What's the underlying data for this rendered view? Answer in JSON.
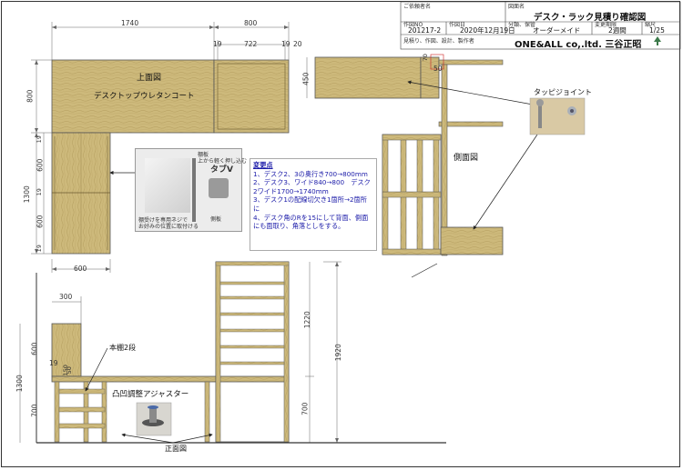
{
  "title_block": {
    "client_label": "ご依頼者名",
    "drawing_name_label": "図面名",
    "drawing_name": "デスク・ラック見積り確認図",
    "work_no_label": "作図NO",
    "work_no": "201217-2",
    "date_label": "作図日",
    "date": "2020年12月19日",
    "category_label": "分類、保管",
    "category": "オーダーメイド",
    "delivery_label": "変更期限",
    "delivery": "2週間",
    "scale_label": "縮尺",
    "scale": "1/25",
    "maker_label": "見積り、作図、設計、製作者",
    "company": "ONE&ALL co,.ltd. 三谷正昭"
  },
  "dimensions": {
    "d1740": "1740",
    "d800": "800",
    "d19a": "19",
    "d722": "722",
    "d19b": "19",
    "d20": "20",
    "d800v": "800",
    "d19v1": "19",
    "d600v": "600",
    "d1300v": "1300",
    "d19v2": "19",
    "d600v2": "600",
    "d19v3": "19",
    "d600h": "600",
    "d450v": "450",
    "d50": "50",
    "d70": "70",
    "d300": "300",
    "d600v3": "600",
    "d1300v2": "1300",
    "d700v": "700",
    "d19v4": "19",
    "d150": "150",
    "d50b": "50",
    "d1220": "1220",
    "d1920": "1920",
    "d700v2": "700"
  },
  "labels": {
    "top_view": "上面図",
    "desktop_coat": "デスクトップウレタンコート",
    "side_view": "側面図",
    "front_view": "正面図",
    "tabby_joint": "タッピジョイント",
    "bookshelf": "本棚2段",
    "adjuster": "凸凹調整アジャスター"
  },
  "photo_tabv": {
    "title": "タブV",
    "note1": "棚板",
    "note2": "上から軽く押し込む",
    "note3": "側板",
    "note4": "棚受けを専用ネジで",
    "note5": "お好みの位置に取付ける"
  },
  "notes": {
    "title": "変更点",
    "items": [
      "1、デスク2、3の奥行き700→800mm",
      "2、デスク3、ワイド840→800　デスク2ワイド1700→1740mm",
      "3、デスク1の配線切欠き1箇所→2箇所に",
      "4、デスク角のRを15にして背面、側面にも面取り、角落としをする。"
    ]
  },
  "colors": {
    "wood": "#cbb779",
    "wood_dark": "#a8935a",
    "wood_grain": "#b9a466",
    "line": "#333333",
    "dim": "#555555",
    "accent_green": "#3c7a4a",
    "note_text": "#1a1aa8"
  }
}
